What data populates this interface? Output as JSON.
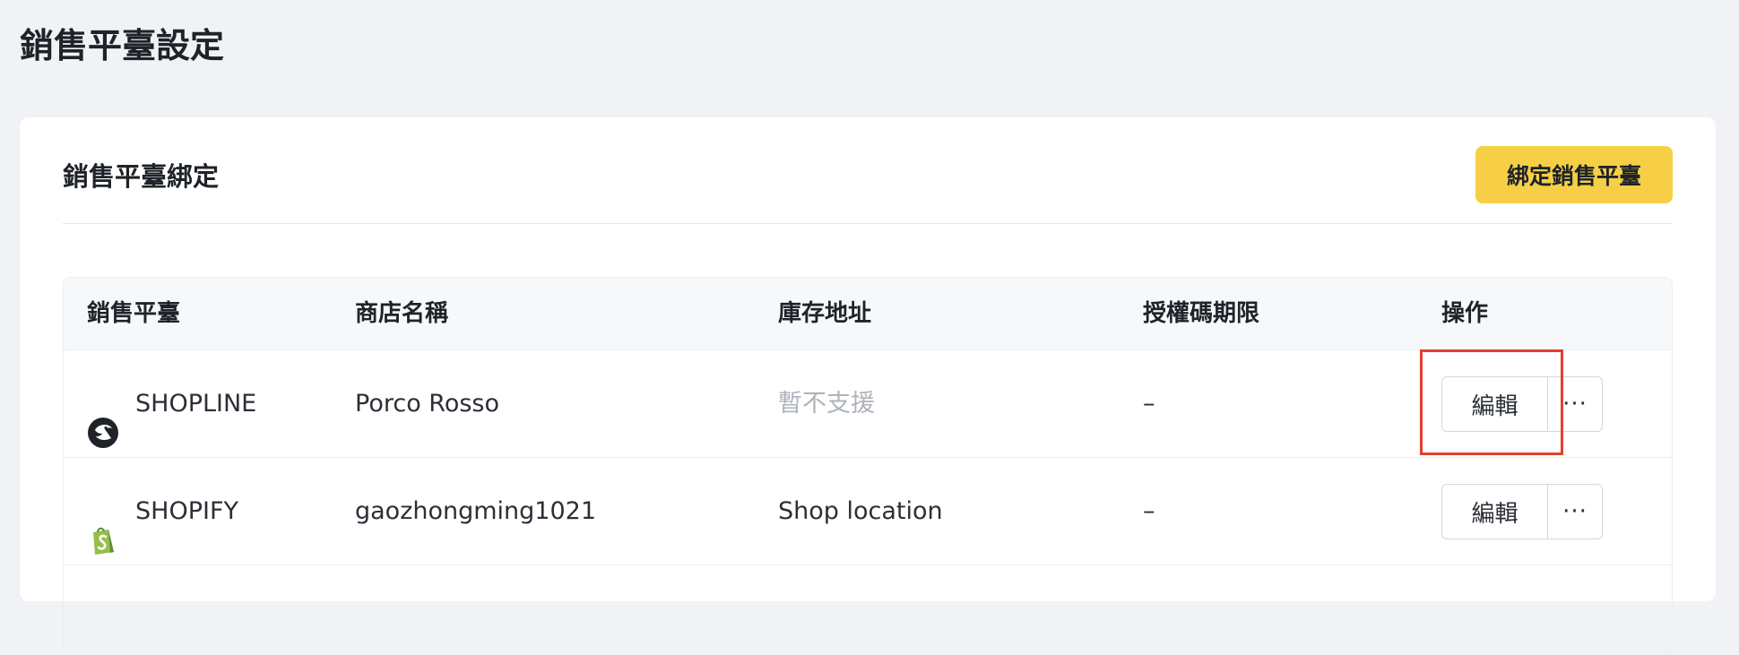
{
  "page": {
    "title": "銷售平臺設定"
  },
  "card": {
    "title": "銷售平臺綁定",
    "bind_button_label": "綁定銷售平臺"
  },
  "table": {
    "headers": [
      "銷售平臺",
      "商店名稱",
      "庫存地址",
      "授權碼期限",
      "操作"
    ],
    "rows": [
      {
        "platform": "SHOPLINE",
        "platform_icon": "shopline-logo-icon",
        "store_name": "Porco Rosso",
        "inventory_address": "暫不支援",
        "auth_expiry": "–",
        "edit_label": "編輯",
        "more_label": "···"
      },
      {
        "platform": "SHOPIFY",
        "platform_icon": "shopify-logo-icon",
        "store_name": "gaozhongming1021",
        "inventory_address": "Shop location",
        "auth_expiry": "–",
        "edit_label": "編輯",
        "more_label": "···"
      }
    ]
  },
  "colors": {
    "page_background": "#f1f2f5",
    "accent_button": "#f6cf47",
    "highlight_border": "#e2412e",
    "muted_text": "#aeb3bb",
    "shopify_green": "#95bf47"
  }
}
